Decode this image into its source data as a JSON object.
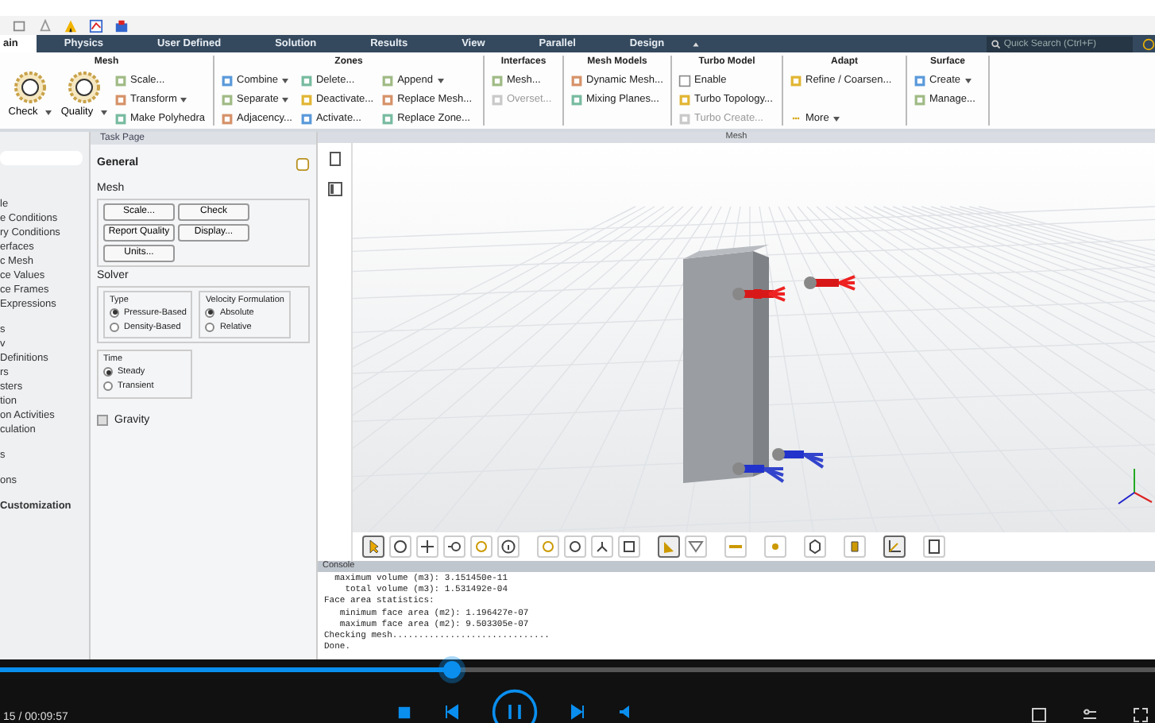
{
  "ribbon_tabs": [
    {
      "label": "ain",
      "selected": true
    },
    {
      "label": "Physics",
      "selected": false
    },
    {
      "label": "User Defined",
      "selected": false
    },
    {
      "label": "Solution",
      "selected": false
    },
    {
      "label": "Results",
      "selected": false
    },
    {
      "label": "View",
      "selected": false
    },
    {
      "label": "Parallel",
      "selected": false
    },
    {
      "label": "Design",
      "selected": false
    }
  ],
  "search": {
    "placeholder": "Quick Search (Ctrl+F)"
  },
  "ribbon_groups": [
    {
      "title": "Mesh",
      "items": [
        {
          "label": "Check",
          "kind": "large",
          "dropdown": true,
          "disabled": false
        },
        {
          "label": "Quality",
          "kind": "large",
          "dropdown": true,
          "disabled": false
        },
        {
          "label": "Scale...",
          "kind": "small",
          "dropdown": false,
          "disabled": false
        },
        {
          "label": "Transform",
          "kind": "small",
          "dropdown": true,
          "disabled": false
        },
        {
          "label": "Make Polyhedra",
          "kind": "small",
          "dropdown": false,
          "disabled": false
        }
      ]
    },
    {
      "title": "Zones",
      "items": [
        {
          "label": "Combine",
          "kind": "small",
          "dropdown": true,
          "disabled": false
        },
        {
          "label": "Separate",
          "kind": "small",
          "dropdown": true,
          "disabled": false
        },
        {
          "label": "Adjacency...",
          "kind": "small",
          "dropdown": false,
          "disabled": false
        },
        {
          "label": "Delete...",
          "kind": "small",
          "dropdown": false,
          "disabled": false
        },
        {
          "label": "Deactivate...",
          "kind": "small",
          "dropdown": false,
          "disabled": false
        },
        {
          "label": "Activate...",
          "kind": "small",
          "dropdown": false,
          "disabled": false
        },
        {
          "label": "Append",
          "kind": "small",
          "dropdown": true,
          "disabled": false
        },
        {
          "label": "Replace Mesh...",
          "kind": "small",
          "dropdown": false,
          "disabled": false
        },
        {
          "label": "Replace Zone...",
          "kind": "small",
          "dropdown": false,
          "disabled": false
        }
      ]
    },
    {
      "title": "Interfaces",
      "items": [
        {
          "label": "Mesh...",
          "kind": "small",
          "dropdown": false,
          "disabled": false
        },
        {
          "label": "Overset...",
          "kind": "small",
          "dropdown": false,
          "disabled": true
        }
      ]
    },
    {
      "title": "Mesh Models",
      "items": [
        {
          "label": "Dynamic Mesh...",
          "kind": "small",
          "dropdown": false,
          "disabled": false
        },
        {
          "label": "Mixing Planes...",
          "kind": "small",
          "dropdown": false,
          "disabled": false
        }
      ]
    },
    {
      "title": "Turbo Model",
      "items": [
        {
          "label": "Enable",
          "kind": "check",
          "dropdown": false,
          "disabled": false
        },
        {
          "label": "Turbo Topology...",
          "kind": "small",
          "dropdown": false,
          "disabled": false
        },
        {
          "label": "Turbo Create...",
          "kind": "small",
          "dropdown": false,
          "disabled": true
        }
      ]
    },
    {
      "title": "Adapt",
      "items": [
        {
          "label": "Refine / Coarsen...",
          "kind": "small",
          "dropdown": false,
          "disabled": false
        },
        {
          "label": "More",
          "kind": "bottom",
          "dropdown": true,
          "disabled": false
        }
      ]
    },
    {
      "title": "Surface",
      "items": [
        {
          "label": "Create",
          "kind": "small",
          "dropdown": true,
          "disabled": false
        },
        {
          "label": "Manage...",
          "kind": "small",
          "dropdown": false,
          "disabled": false
        }
      ]
    }
  ],
  "tree": {
    "groups": [
      [
        "le",
        "e Conditions",
        "ry Conditions",
        "erfaces",
        "c Mesh",
        "ce Values",
        "ce Frames",
        "Expressions"
      ],
      [
        "s",
        "v",
        "Definitions",
        "rs",
        "sters",
        "tion",
        "on Activities",
        "culation"
      ],
      [
        "s"
      ],
      [
        "ons"
      ],
      [
        "Customization"
      ]
    ]
  },
  "task_page": {
    "title": "Task Page",
    "heading": "General",
    "mesh_label": "Mesh",
    "mesh_buttons": [
      "Scale...",
      "Check",
      "Report Quality",
      "Display...",
      "Units..."
    ],
    "solver_label": "Solver",
    "type": {
      "label": "Type",
      "options": [
        {
          "label": "Pressure-Based",
          "selected": true
        },
        {
          "label": "Density-Based",
          "selected": false
        }
      ]
    },
    "velocity": {
      "label": "Velocity Formulation",
      "options": [
        {
          "label": "Absolute",
          "selected": true
        },
        {
          "label": "Relative",
          "selected": false
        }
      ]
    },
    "time": {
      "label": "Time",
      "options": [
        {
          "label": "Steady",
          "selected": true
        },
        {
          "label": "Transient",
          "selected": false
        }
      ]
    },
    "gravity": {
      "label": "Gravity",
      "checked": false
    }
  },
  "viewport": {
    "title": "Mesh"
  },
  "viewport_tools": [
    {
      "selected": true
    },
    {
      "selected": false
    },
    {
      "selected": false
    },
    {
      "selected": false
    },
    {
      "selected": false
    },
    {
      "selected": false
    },
    {
      "selected": false
    },
    {
      "selected": false
    },
    {
      "selected": false
    },
    {
      "selected": false
    },
    {
      "selected": true
    },
    {
      "selected": false
    },
    {
      "selected": false
    },
    {
      "selected": false
    },
    {
      "selected": false
    },
    {
      "selected": false
    },
    {
      "selected": true
    },
    {
      "selected": false
    }
  ],
  "console": {
    "title": "Console",
    "lines": [
      "  maximum volume (m3): 3.151450e-11",
      "    total volume (m3): 1.531492e-04",
      "Face area statistics:",
      "   minimum face area (m2): 1.196427e-07",
      "   maximum face area (m2): 9.503305e-07",
      "Checking mesh..............................",
      "Done."
    ]
  },
  "player": {
    "time": "15 / 00:09:57",
    "level": 0.39
  }
}
